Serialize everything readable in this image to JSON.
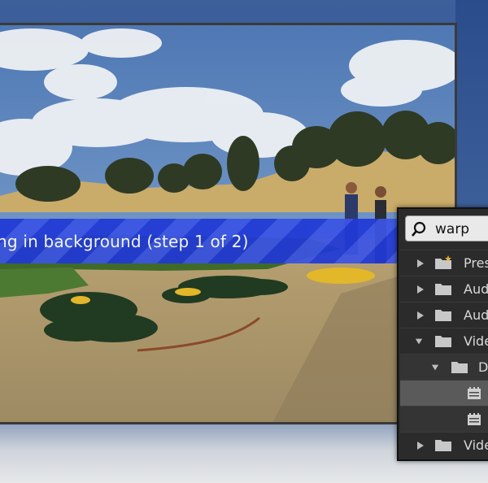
{
  "video": {
    "banner_text": "ng in background (step 1 of 2)"
  },
  "effects_panel": {
    "search": {
      "value": "warp"
    },
    "tree": [
      {
        "label": "Pres",
        "kind": "preset-folder",
        "expanded": false
      },
      {
        "label": "Aud",
        "kind": "folder",
        "expanded": false
      },
      {
        "label": "Aud",
        "kind": "folder",
        "expanded": false
      },
      {
        "label": "Vide",
        "kind": "folder",
        "expanded": true
      },
      {
        "label": "D",
        "kind": "folder",
        "expanded": true
      },
      {
        "label": "",
        "kind": "effect",
        "selected": true
      },
      {
        "label": "",
        "kind": "effect",
        "selected": false
      },
      {
        "label": "Vide",
        "kind": "folder",
        "expanded": false
      }
    ]
  },
  "colors": {
    "banner": "#2039d6",
    "panel_bg": "#2b2b2b",
    "folder": "#c8c8c8"
  }
}
